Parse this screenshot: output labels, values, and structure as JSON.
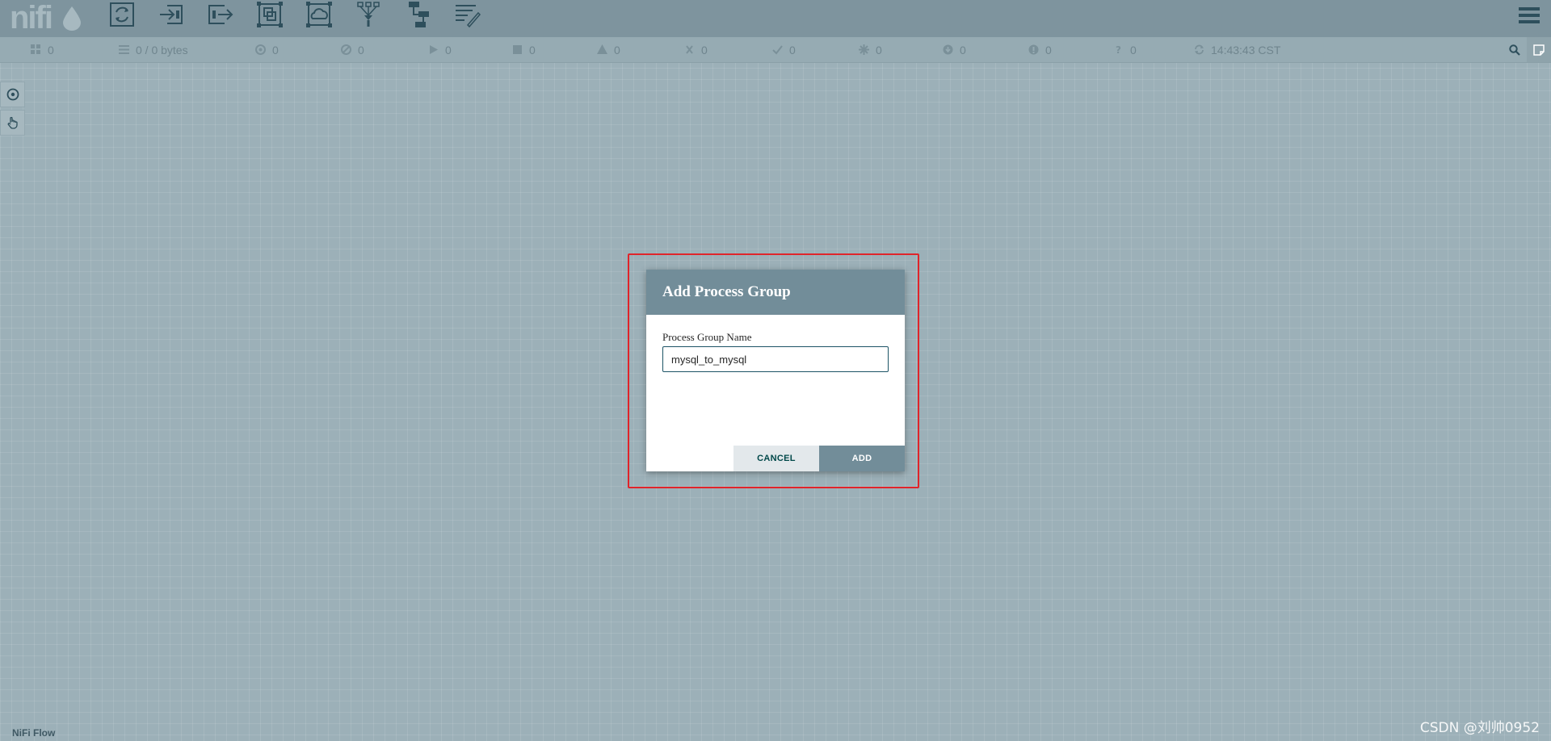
{
  "app": {
    "logo_text": "nifi",
    "breadcrumb": "NiFi Flow",
    "watermark": "CSDN @刘帅0952"
  },
  "toolbar": {
    "items": [
      {
        "icon": "processor-icon"
      },
      {
        "icon": "input-port-icon"
      },
      {
        "icon": "output-port-icon"
      },
      {
        "icon": "process-group-icon"
      },
      {
        "icon": "remote-process-group-icon"
      },
      {
        "icon": "funnel-icon"
      },
      {
        "icon": "template-icon"
      },
      {
        "icon": "label-icon"
      }
    ]
  },
  "status": {
    "items": [
      {
        "icon": "cluster-icon",
        "value": "0"
      },
      {
        "icon": "queued-icon",
        "value": "0 / 0 bytes"
      },
      {
        "icon": "transmitting-icon",
        "value": "0"
      },
      {
        "icon": "not-transmitting-icon",
        "value": "0"
      },
      {
        "icon": "running-icon",
        "value": "0"
      },
      {
        "icon": "stopped-icon",
        "value": "0"
      },
      {
        "icon": "invalid-icon",
        "value": "0"
      },
      {
        "icon": "disabled-icon",
        "value": "0"
      },
      {
        "icon": "up-to-date-icon",
        "value": "0"
      },
      {
        "icon": "locally-modified-icon",
        "value": "0"
      },
      {
        "icon": "stale-icon",
        "value": "0"
      },
      {
        "icon": "locally-modified-stale-icon",
        "value": "0"
      },
      {
        "icon": "sync-failure-icon",
        "value": "0"
      }
    ],
    "refresh_time": "14:43:43 CST"
  },
  "dialog": {
    "title": "Add Process Group",
    "field_label": "Process Group Name",
    "name_value": "mysql_to_mysql",
    "cancel_label": "CANCEL",
    "add_label": "ADD"
  },
  "colors": {
    "header": "#7e949e",
    "canvas": "#9cb0b8",
    "dialog_header": "#728d99",
    "highlight": "#e0242a"
  }
}
